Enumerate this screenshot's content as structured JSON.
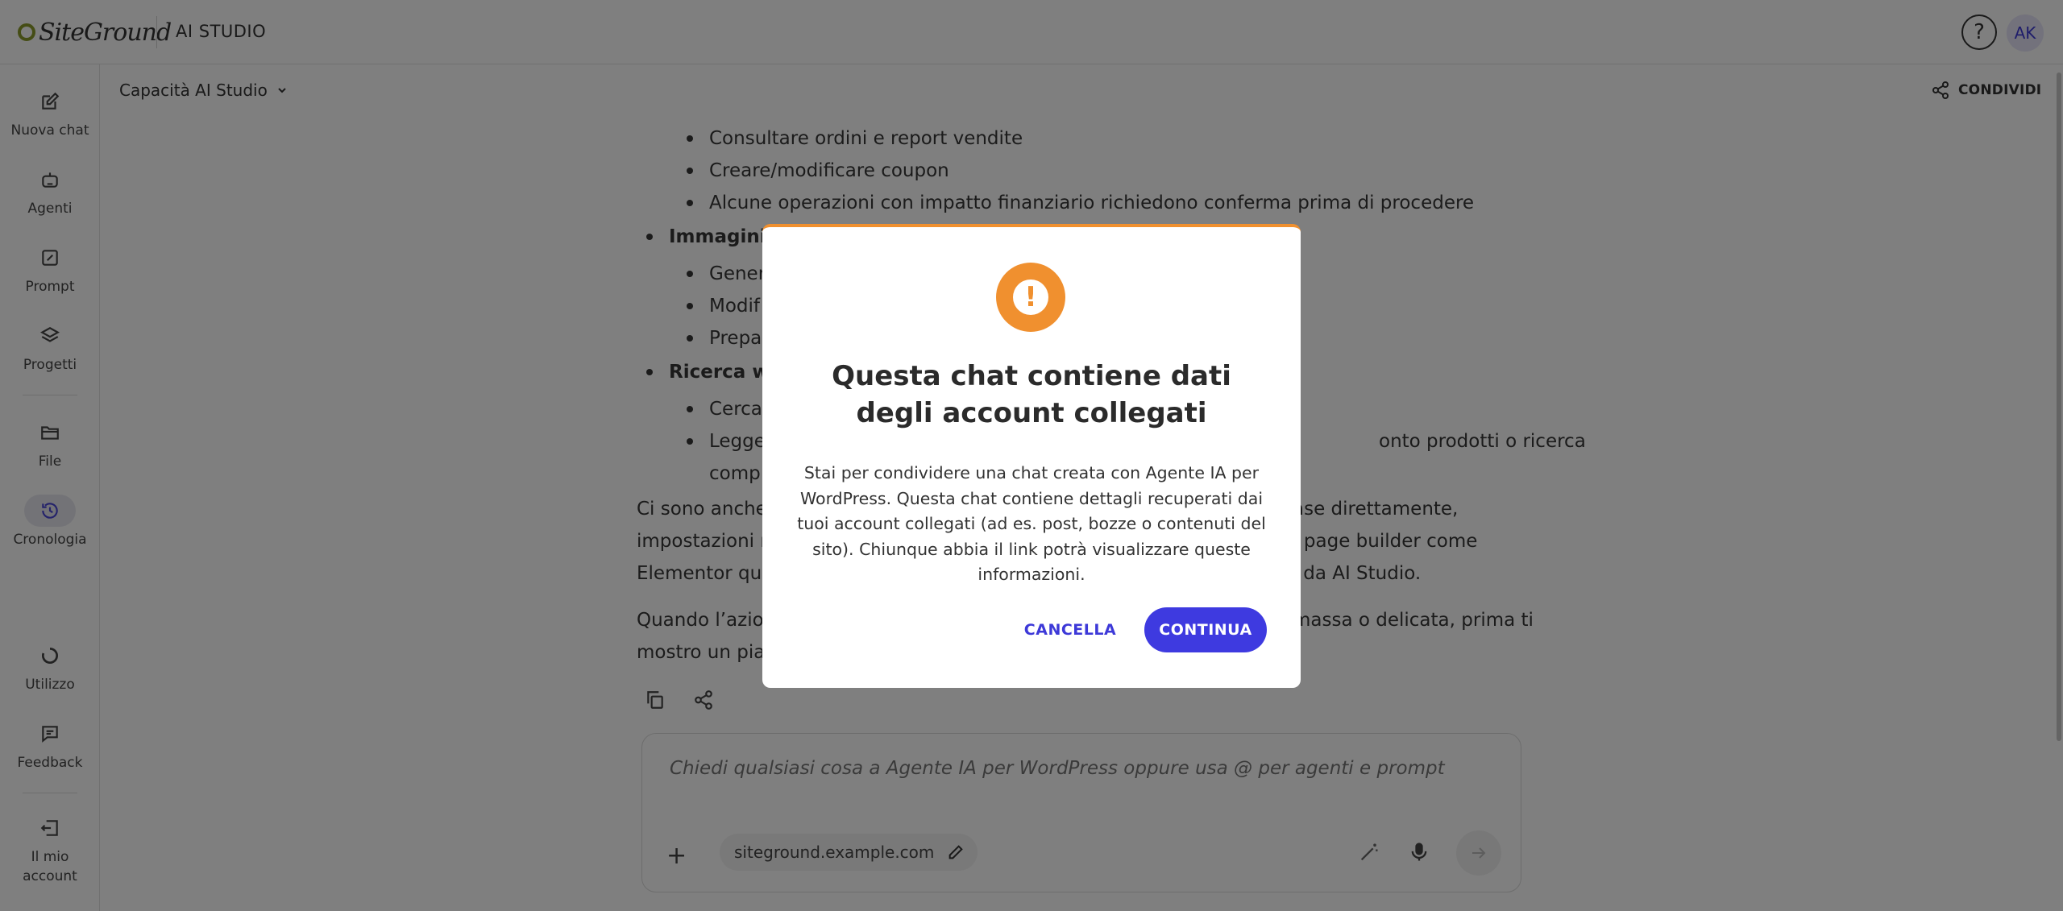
{
  "header": {
    "logo_text": "SiteGround",
    "app_title": "AI STUDIO",
    "help_icon": "question-circle-icon",
    "avatar_initials": "AK"
  },
  "sidebar": {
    "items": [
      {
        "label": "Nuova chat",
        "icon": "edit-icon"
      },
      {
        "label": "Agenti",
        "icon": "robot-icon"
      },
      {
        "label": "Prompt",
        "icon": "prompt-icon"
      },
      {
        "label": "Progetti",
        "icon": "layers-icon"
      },
      {
        "label": "File",
        "icon": "folder-icon"
      },
      {
        "label": "Cronologia",
        "icon": "history-icon"
      },
      {
        "label": "Utilizzo",
        "icon": "usage-icon"
      },
      {
        "label": "Feedback",
        "icon": "feedback-icon"
      },
      {
        "label": "Il mio account",
        "icon": "logout-icon"
      }
    ]
  },
  "main": {
    "model_picker": "Capacità AI Studio",
    "share_label": "CONDIVIDI",
    "content": {
      "sub_bullets_top": [
        "Consultare ordini e report vendite",
        "Creare/modificare coupon",
        "Alcune operazioni con impatto finanziario richiedono conferma prima di procedere"
      ],
      "heading_images": "Immagini",
      "images_bullets": [
        "Gener",
        "Modif",
        "Prepa"
      ],
      "heading_web": "Ricerca we",
      "web_bullets": [
        "Cerca",
        "Legge"
      ],
      "web_bullet_right": "onto prodotti o ricerca",
      "web_bullet_cont": "comp",
      "para1_left": [
        "Ci sono anche",
        "impostazioni n",
        "Elementor qua"
      ],
      "para1_right": [
        "ase direttamente,",
        "ntro page builder come",
        "ori da AI Studio."
      ],
      "para2_left": [
        "Quando l’azion",
        "mostro un pian"
      ],
      "para2_right": [
        "massa o delicata, prima ti",
        ""
      ]
    },
    "composer": {
      "placeholder": "Chiedi qualsiasi cosa a Agente IA per WordPress oppure usa @ per agenti e prompt",
      "site_chip": "siteground.example.com"
    }
  },
  "modal": {
    "title": "Questa chat contiene dati degli account collegati",
    "body": "Stai per condividere una chat creata con Agente IA per WordPress. Questa chat contiene dettagli recuperati dai tuoi account collegati (ad es. post, bozze o contenuti del sito). Chiunque abbia il link potrà visualizzare queste informazioni.",
    "cancel_label": "CANCELLA",
    "continue_label": "CONTINUA",
    "accent_color": "#f0902f",
    "primary_color": "#3e3ae0"
  }
}
